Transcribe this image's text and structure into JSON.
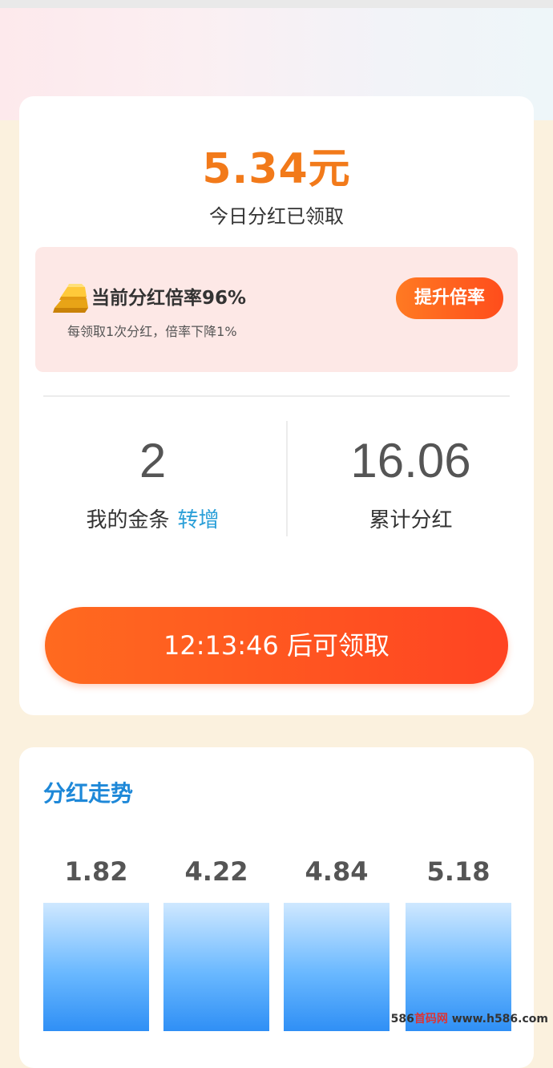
{
  "dividend": {
    "amount": "5.34元",
    "caption": "今日分红已领取"
  },
  "rate_box": {
    "title": "当前分红倍率96%",
    "subtitle": "每领取1次分红，倍率下降1%",
    "boost_label": "提升倍率",
    "icon": "gold-bar-icon"
  },
  "stats": {
    "gold_bars": {
      "value": "2",
      "label": "我的金条",
      "link_label": "转增"
    },
    "total": {
      "value": "16.06",
      "label": "累计分红"
    }
  },
  "claim_button": {
    "label": "12:13:46 后可领取"
  },
  "trend": {
    "title": "分红走势"
  },
  "chart_data": {
    "type": "bar",
    "values": [
      1.82,
      4.22,
      4.84,
      5.18
    ],
    "value_labels": [
      "1.82",
      "4.22",
      "4.84",
      "5.18"
    ]
  },
  "watermark": {
    "prefix": "586",
    "cn": "首码网",
    "suffix": " www.h586.com"
  },
  "colors": {
    "accent_orange": "#f27a1a",
    "button_gradient_start": "#ff6a1f",
    "button_gradient_end": "#ff4422",
    "link_blue": "#2a9fd8",
    "trend_title_blue": "#1e88d8",
    "page_bg": "#fbf1de"
  }
}
